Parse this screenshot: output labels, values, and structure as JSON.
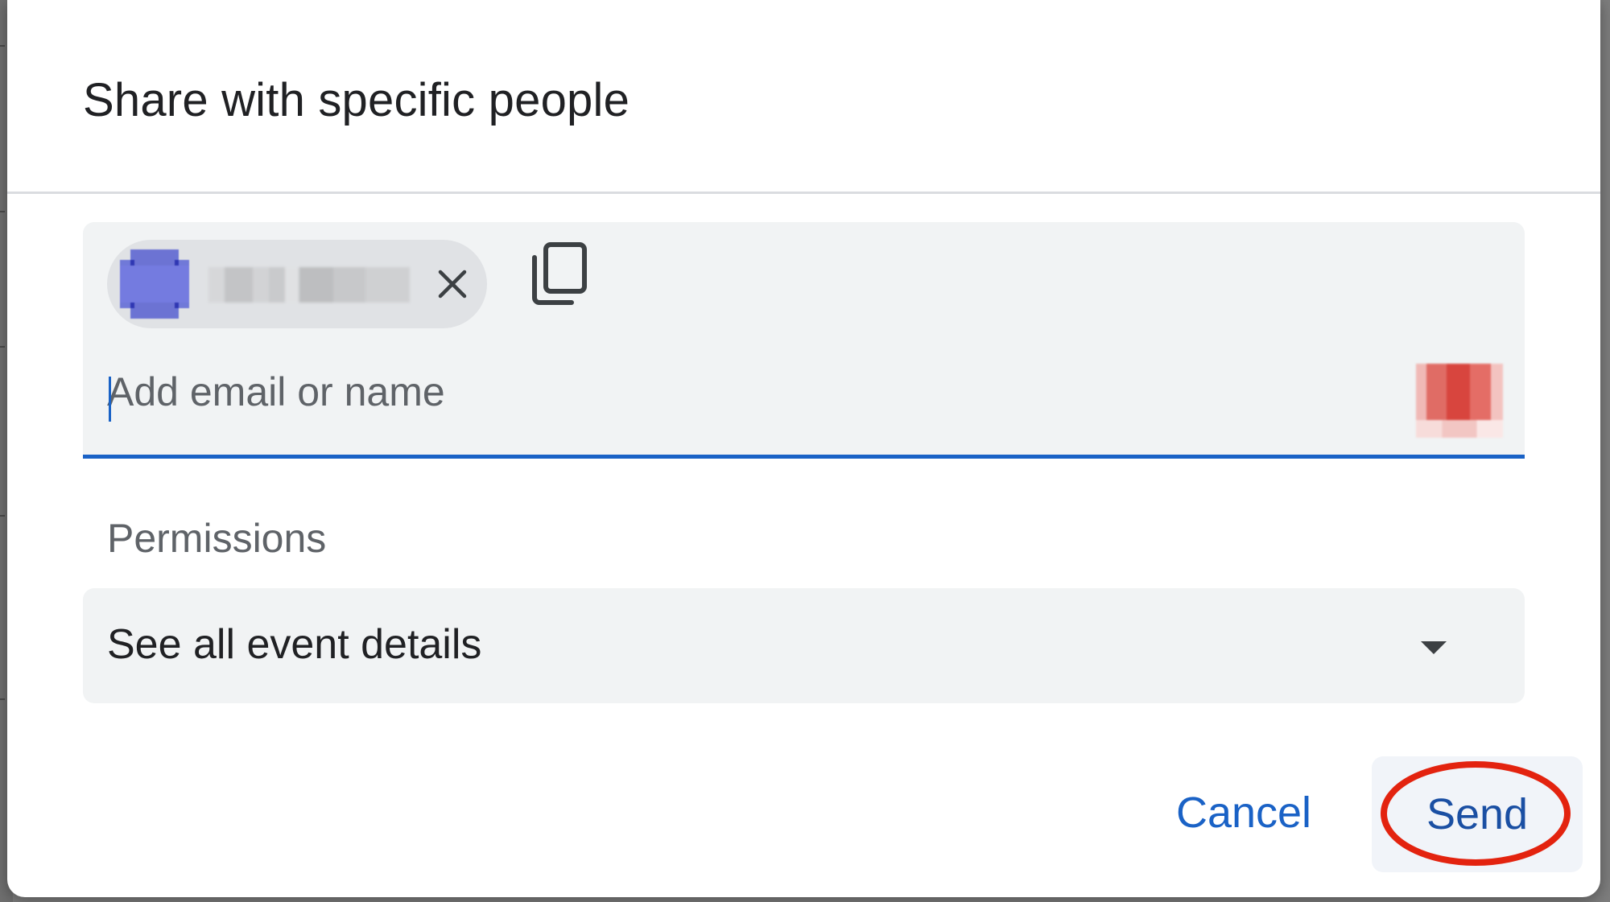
{
  "dialog": {
    "title": "Share with specific people"
  },
  "recipients": {
    "chips": [
      {
        "avatar_color": "#6c73d3"
      }
    ],
    "input_placeholder": "Add email or name",
    "input_value": ""
  },
  "permissions": {
    "label": "Permissions",
    "selected": "See all event details"
  },
  "actions": {
    "cancel_label": "Cancel",
    "send_label": "Send"
  },
  "colors": {
    "accent": "#1a62c6",
    "highlight_ring": "#e3230f"
  },
  "icons": {
    "chip_remove": "close-icon",
    "copy": "copy-icon",
    "contacts": "contacts-icon",
    "dropdown": "arrow-drop-down-icon"
  }
}
